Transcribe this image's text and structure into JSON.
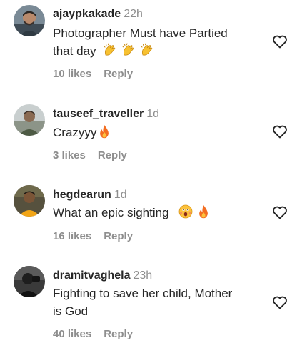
{
  "comments": [
    {
      "username": "ajaypkakade",
      "time": "22h",
      "text_lines": [
        "Photographer Must have Partied",
        "that day"
      ],
      "emojis": [
        "clapping-hands-icon",
        "clapping-hands-icon",
        "clapping-hands-icon"
      ],
      "likes": "10 likes",
      "reply": "Reply"
    },
    {
      "username": "tauseef_traveller",
      "time": "1d",
      "text_lines": [
        "Crazyyy"
      ],
      "emojis": [
        "fire-icon"
      ],
      "likes": "3 likes",
      "reply": "Reply"
    },
    {
      "username": "hegdearun",
      "time": "1d",
      "text_lines": [
        "What an epic sighting"
      ],
      "emojis": [
        "astonished-face-icon",
        "fire-icon"
      ],
      "likes": "16 likes",
      "reply": "Reply"
    },
    {
      "username": "dramitvaghela",
      "time": "23h",
      "text_lines": [
        "Fighting to save her child, Mother",
        "is God"
      ],
      "emojis": [],
      "likes": "40 likes",
      "reply": "Reply"
    }
  ],
  "colors": {
    "text": "#262626",
    "muted": "#8e8e8e",
    "background": "#ffffff",
    "fire": "#f36d21",
    "clap": "#f7c131"
  }
}
